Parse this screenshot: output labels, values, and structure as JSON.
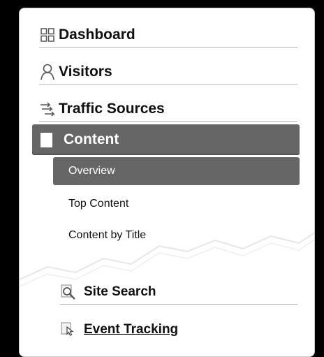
{
  "nav": {
    "dashboard": {
      "label": "Dashboard",
      "icon": "grid-icon"
    },
    "visitors": {
      "label": "Visitors",
      "icon": "person-icon"
    },
    "traffic_sources": {
      "label": "Traffic Sources",
      "icon": "arrows-icon"
    },
    "content": {
      "label": "Content",
      "icon": "page-icon",
      "items": [
        {
          "label": "Overview",
          "active": true
        },
        {
          "label": "Top Content",
          "active": false
        },
        {
          "label": "Content by Title",
          "active": false
        }
      ]
    },
    "site_search": {
      "label": "Site Search",
      "icon": "magnifier-icon"
    },
    "event_tracking": {
      "label": "Event Tracking",
      "icon": "cursor-click-icon"
    }
  },
  "colors": {
    "background": "#000000",
    "panel": "#ffffff",
    "active": "#666666",
    "divider": "#b8b8b8"
  }
}
